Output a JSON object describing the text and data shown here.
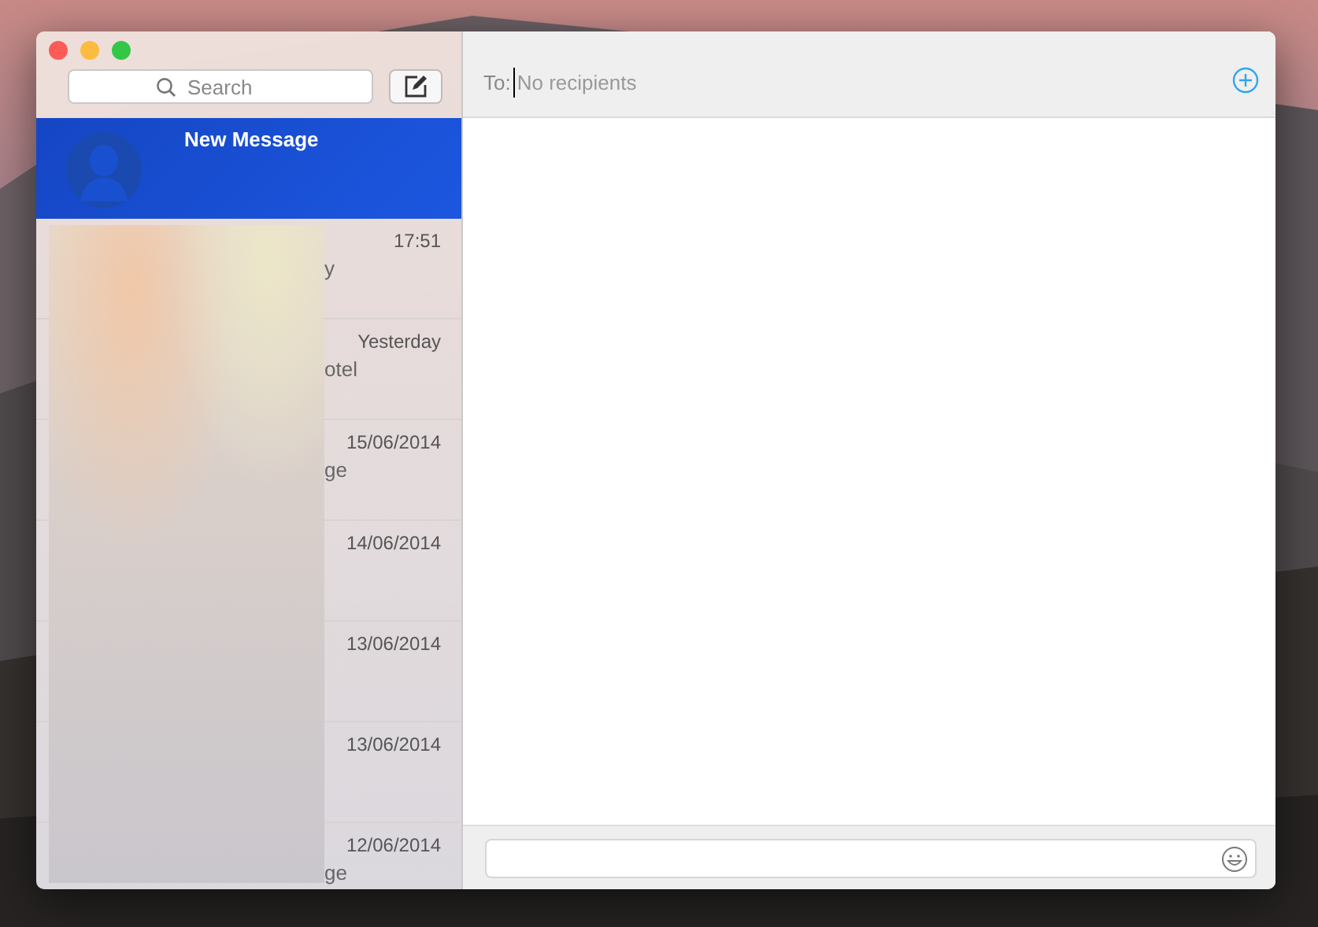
{
  "search": {
    "placeholder": "Search"
  },
  "new_message": {
    "title": "New Message",
    "selected": true
  },
  "conversations": [
    {
      "time": "17:51",
      "preview": "y",
      "selected": false
    },
    {
      "time": "Yesterday",
      "preview": "otel",
      "selected": false
    },
    {
      "time": "15/06/2014",
      "preview": "ge",
      "selected": false
    },
    {
      "time": "14/06/2014",
      "selected": false
    },
    {
      "time": "13/06/2014",
      "selected": false
    },
    {
      "time": "13/06/2014",
      "selected": false
    },
    {
      "time": "12/06/2014",
      "preview": "ge",
      "selected": false
    }
  ],
  "to_field": {
    "label": "To:",
    "placeholder": "No recipients"
  }
}
